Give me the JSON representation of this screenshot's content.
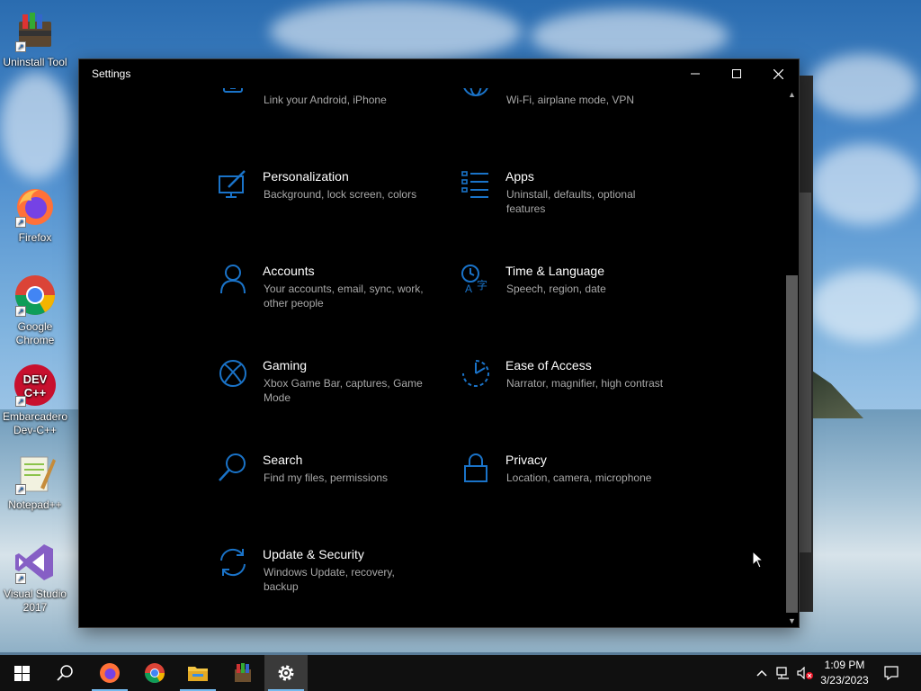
{
  "desktop": {
    "icons": [
      {
        "label": "Uninstall Tool",
        "icon": "uninstall-tool-icon"
      },
      {
        "label": "Firefox",
        "icon": "firefox-icon"
      },
      {
        "label": "Google Chrome",
        "icon": "chrome-icon"
      },
      {
        "label": "Embarcadero Dev-C++",
        "icon": "devcpp-icon"
      },
      {
        "label": "Notepad++",
        "icon": "notepadpp-icon"
      },
      {
        "label": "Visual Studio 2017",
        "icon": "visual-studio-icon"
      }
    ]
  },
  "window": {
    "title": "Settings",
    "controls": {
      "minimize": "—",
      "maximize": "☐",
      "close": "✕"
    },
    "accent": "#1a73c8",
    "tiles": [
      {
        "name": "",
        "desc": "Link your Android, iPhone",
        "icon": "phone-icon"
      },
      {
        "name": "",
        "desc": "Wi-Fi, airplane mode, VPN",
        "icon": "globe-icon"
      },
      {
        "name": "Personalization",
        "desc": "Background, lock screen, colors",
        "icon": "personalization-icon"
      },
      {
        "name": "Apps",
        "desc": "Uninstall, defaults, optional features",
        "icon": "apps-icon"
      },
      {
        "name": "Accounts",
        "desc": "Your accounts, email, sync, work, other people",
        "icon": "person-icon"
      },
      {
        "name": "Time & Language",
        "desc": "Speech, region, date",
        "icon": "time-language-icon"
      },
      {
        "name": "Gaming",
        "desc": "Xbox Game Bar, captures, Game Mode",
        "icon": "xbox-icon"
      },
      {
        "name": "Ease of Access",
        "desc": "Narrator, magnifier, high contrast",
        "icon": "ease-of-access-icon"
      },
      {
        "name": "Search",
        "desc": "Find my files, permissions",
        "icon": "search-icon"
      },
      {
        "name": "Privacy",
        "desc": "Location, camera, microphone",
        "icon": "lock-icon"
      },
      {
        "name": "Update & Security",
        "desc": "Windows Update, recovery, backup",
        "icon": "update-icon"
      }
    ]
  },
  "taskbar": {
    "start": "start-icon",
    "search": "search-icon",
    "apps": [
      "firefox-icon",
      "chrome-icon",
      "file-explorer-icon",
      "winrar-icon",
      "settings-gear-icon"
    ],
    "tray": {
      "chevron": "^",
      "network": "network-icon",
      "volume": "volume-muted-icon"
    },
    "clock": {
      "time": "1:09 PM",
      "date": "3/23/2023"
    },
    "notification": "notification-icon"
  }
}
